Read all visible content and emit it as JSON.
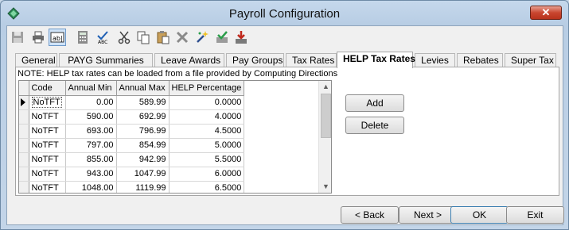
{
  "window": {
    "title": "Payroll Configuration",
    "close_label": "✕"
  },
  "toolbar": {
    "buttons": [
      {
        "name": "save-icon"
      },
      {
        "name": "print-icon"
      },
      {
        "name": "text-field-icon",
        "label": "ab|"
      },
      {
        "name": "calculator-icon"
      },
      {
        "name": "spell-check-icon"
      },
      {
        "name": "cut-icon"
      },
      {
        "name": "copy-icon"
      },
      {
        "name": "paste-icon"
      },
      {
        "name": "delete-icon"
      },
      {
        "name": "wand-icon"
      },
      {
        "name": "approve-icon"
      },
      {
        "name": "import-icon"
      }
    ]
  },
  "tabs": [
    {
      "label": "General"
    },
    {
      "label": "PAYG Summaries"
    },
    {
      "label": "Leave Awards"
    },
    {
      "label": "Pay Groups"
    },
    {
      "label": "Tax Rates"
    },
    {
      "label": "HELP Tax Rates",
      "active": true
    },
    {
      "label": "Levies"
    },
    {
      "label": "Rebates"
    },
    {
      "label": "Super Tax"
    }
  ],
  "note": "NOTE: HELP tax rates can be loaded from a file provided by Computing Directions",
  "grid": {
    "columns": [
      "Code",
      "Annual Min",
      "Annual Max",
      "HELP Percentage"
    ],
    "rows": [
      [
        "NoTFT",
        "0.00",
        "589.99",
        "0.0000"
      ],
      [
        "NoTFT",
        "590.00",
        "692.99",
        "4.0000"
      ],
      [
        "NoTFT",
        "693.00",
        "796.99",
        "4.5000"
      ],
      [
        "NoTFT",
        "797.00",
        "854.99",
        "5.0000"
      ],
      [
        "NoTFT",
        "855.00",
        "942.99",
        "5.5000"
      ],
      [
        "NoTFT",
        "943.00",
        "1047.99",
        "6.0000"
      ],
      [
        "NoTFT",
        "1048.00",
        "1119.99",
        "6.5000"
      ]
    ]
  },
  "side_buttons": {
    "add": "Add",
    "delete": "Delete"
  },
  "footer": {
    "back": "< Back",
    "next": "Next >",
    "ok": "OK",
    "exit": "Exit"
  }
}
